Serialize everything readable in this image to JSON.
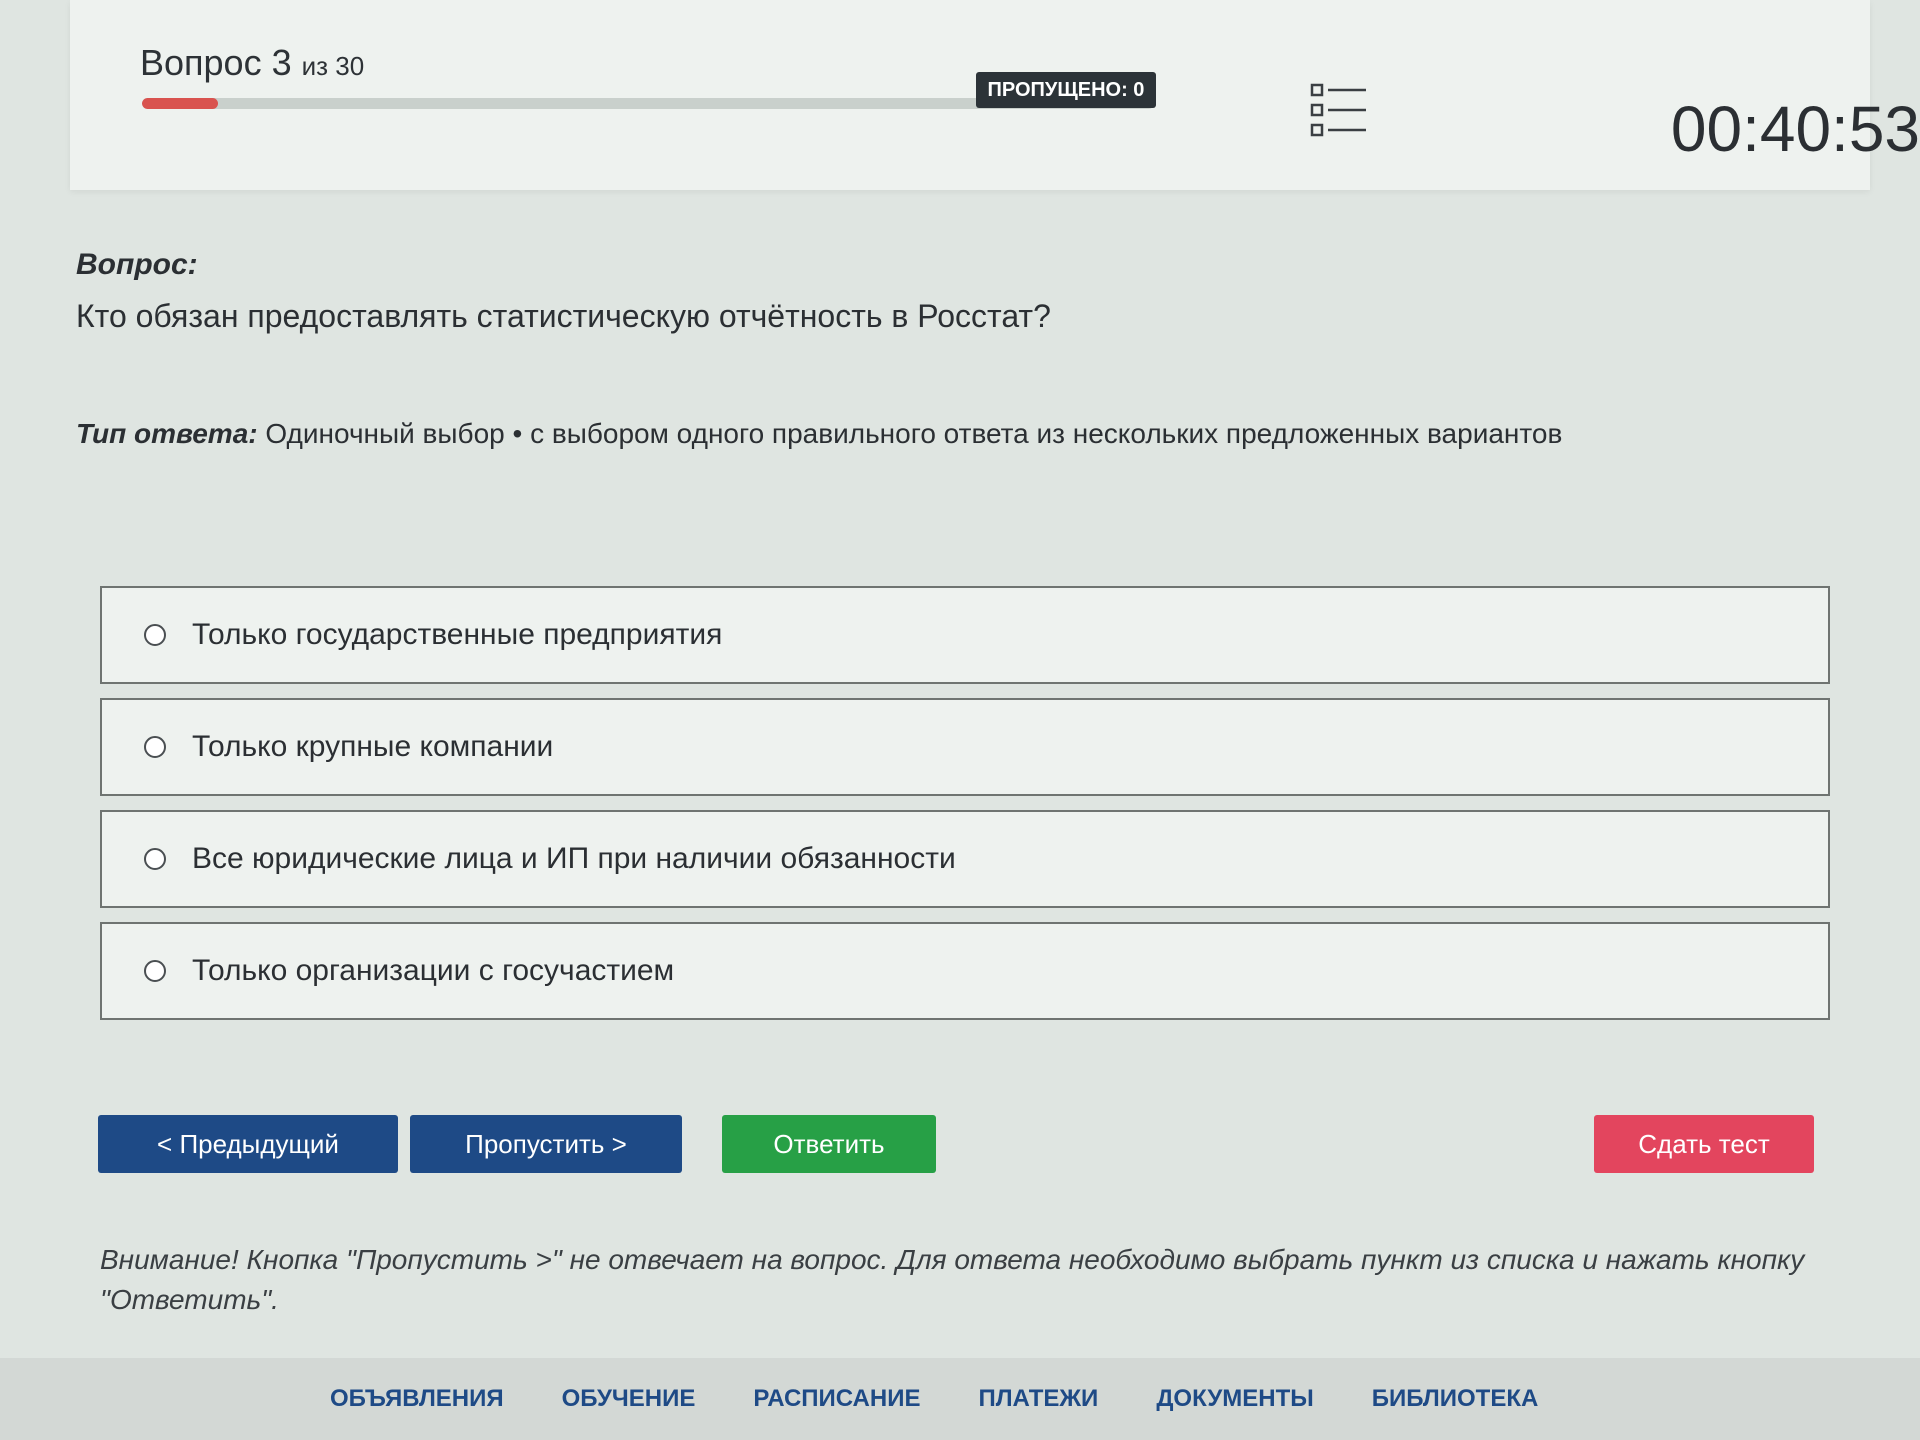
{
  "header": {
    "question_word": "Вопрос 3",
    "question_of": "из 30",
    "progress_fraction": 0.075,
    "skipped_label": "ПРОПУЩЕНО: 0",
    "timer": "00:40:53"
  },
  "question": {
    "heading": "Вопрос:",
    "text": "Кто обязан предоставлять статистическую отчётность в Росстат?"
  },
  "answer_type": {
    "label": "Тип ответа:",
    "value": "Одиночный выбор • с выбором одного правильного ответа из нескольких предложенных вариантов"
  },
  "options": [
    {
      "label": "Только государственные предприятия"
    },
    {
      "label": "Только крупные компании"
    },
    {
      "label": "Все юридические лица и ИП при наличии обязанности"
    },
    {
      "label": "Только организации с госучастием"
    }
  ],
  "buttons": {
    "prev": "< Предыдущий",
    "skip": "Пропустить >",
    "answer": "Ответить",
    "submit": "Сдать тест"
  },
  "warning": "Внимание! Кнопка \"Пропустить >\" не отвечает на вопрос. Для ответа необходимо выбрать пункт из списка и нажать кнопку \"Ответить\".",
  "footer_nav": [
    "ОБЪЯВЛЕНИЯ",
    "ОБУЧЕНИЕ",
    "РАСПИСАНИЕ",
    "ПЛАТЕЖИ",
    "ДОКУМЕНТЫ",
    "БИБЛИОТЕКА"
  ],
  "colors": {
    "primary": "#1e4a86",
    "success": "#27a046",
    "danger": "#e3455e",
    "progress": "#d9534f"
  }
}
